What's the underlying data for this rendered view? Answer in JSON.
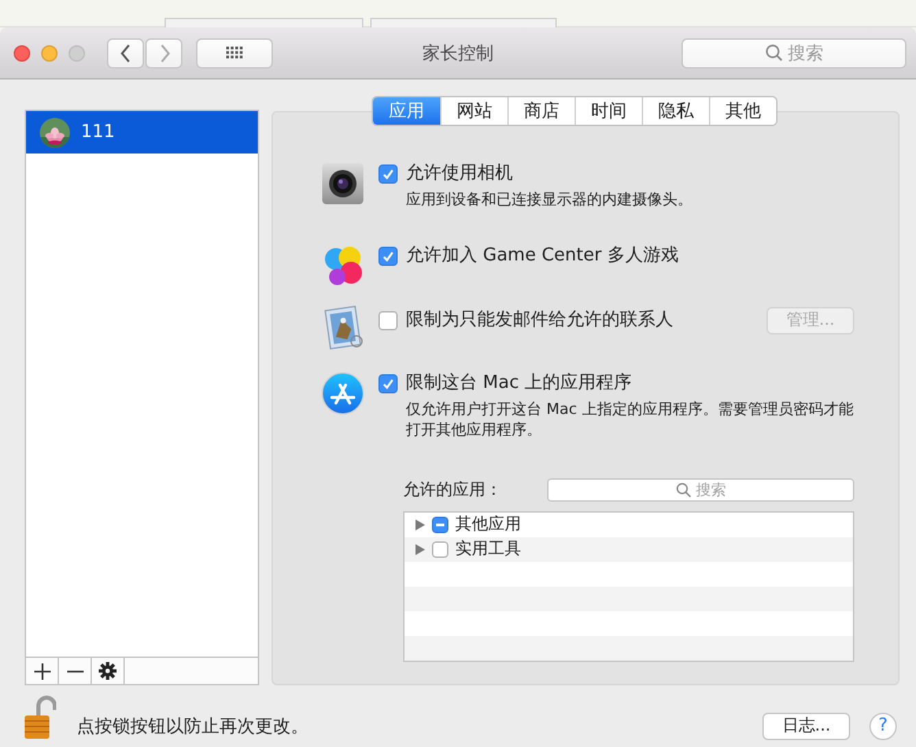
{
  "window": {
    "title": "家长控制",
    "search": {
      "placeholder": "搜索"
    }
  },
  "sidebar": {
    "users": [
      {
        "name": "111",
        "selected": true
      }
    ]
  },
  "tabs": [
    {
      "label": "应用",
      "selected": true
    },
    {
      "label": "网站",
      "selected": false
    },
    {
      "label": "商店",
      "selected": false
    },
    {
      "label": "时间",
      "selected": false
    },
    {
      "label": "隐私",
      "selected": false
    },
    {
      "label": "其他",
      "selected": false
    }
  ],
  "settings": [
    {
      "kind": "camera",
      "label": "允许使用相机",
      "checked": true,
      "description": "应用到设备和已连接显示器的内建摄像头。"
    },
    {
      "kind": "game",
      "label": "允许加入 Game Center 多人游戏",
      "checked": true
    },
    {
      "kind": "mail",
      "label": "限制为只能发邮件给允许的联系人",
      "checked": false,
      "button": {
        "label": "管理...",
        "disabled": true
      }
    },
    {
      "kind": "apps",
      "label": "限制这台 Mac 上的应用程序",
      "checked": true,
      "description": "仅允许用户打开这台 Mac 上指定的应用程序。需要管理员密码才能打开其他应用程序。"
    }
  ],
  "allowed_apps": {
    "label": "允许的应用：",
    "search": {
      "placeholder": "搜索"
    },
    "items": [
      {
        "label": "其他应用",
        "checked": false,
        "mixed": true,
        "expanded": false
      },
      {
        "label": "实用工具",
        "checked": false,
        "mixed": false,
        "expanded": false
      }
    ]
  },
  "footer": {
    "lock_text": "点按锁按钮以防止再次更改。",
    "log_button": "日志...",
    "help": "?"
  }
}
